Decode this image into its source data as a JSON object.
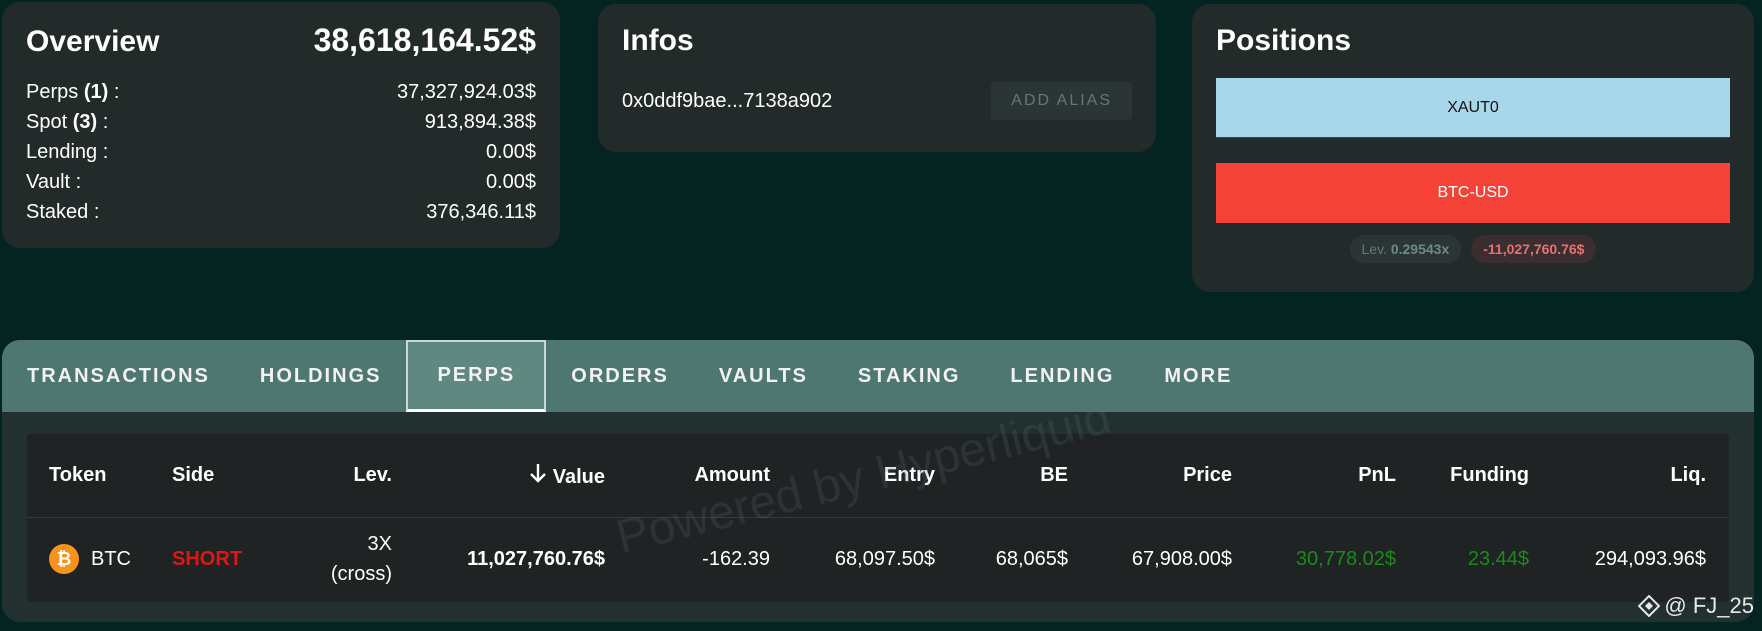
{
  "overview": {
    "title": "Overview",
    "total": "38,618,164.52$",
    "rows": [
      {
        "label": "Perps ",
        "count": "(1)",
        "suffix": " :",
        "value": "37,327,924.03$"
      },
      {
        "label": "Spot ",
        "count": "(3)",
        "suffix": " :",
        "value": "913,894.38$"
      },
      {
        "label": "Lending :",
        "count": "",
        "suffix": "",
        "value": "0.00$"
      },
      {
        "label": "Vault :",
        "count": "",
        "suffix": "",
        "value": "0.00$"
      },
      {
        "label": "Staked :",
        "count": "",
        "suffix": "",
        "value": "376,346.11$"
      }
    ]
  },
  "infos": {
    "title": "Infos",
    "address": "0x0ddf9bae...7138a902",
    "add_alias_label": "ADD ALIAS"
  },
  "positions": {
    "title": "Positions",
    "items": [
      "XAUT0",
      "BTC-USD"
    ],
    "lev_label": "Lev.",
    "lev_value": "0.29543x",
    "pnl": "-11,027,760.76$",
    "colors": {
      "xaut0": "#a8d7ea",
      "btc_usd": "#f44336"
    }
  },
  "tabs": [
    "TRANSACTIONS",
    "HOLDINGS",
    "PERPS",
    "ORDERS",
    "VAULTS",
    "STAKING",
    "LENDING",
    "MORE"
  ],
  "active_tab": "PERPS",
  "table": {
    "headers": {
      "token": "Token",
      "side": "Side",
      "lev": "Lev.",
      "value": "Value",
      "amount": "Amount",
      "entry": "Entry",
      "be": "BE",
      "price": "Price",
      "pnl": "PnL",
      "funding": "Funding",
      "liq": "Liq."
    },
    "sort_icon": "arrow-down-icon",
    "rows": [
      {
        "token": "BTC",
        "token_icon": "bitcoin-icon",
        "side": "SHORT",
        "lev_line1": "3X",
        "lev_line2": "(cross)",
        "value": "11,027,760.76$",
        "amount": "-162.39",
        "entry": "68,097.50$",
        "be": "68,065$",
        "price": "67,908.00$",
        "pnl": "30,778.02$",
        "funding": "23.44$",
        "liq": "294,093.96$"
      }
    ]
  },
  "watermark": "Powered by Hyperliquid",
  "credit": "@ FJ_25"
}
